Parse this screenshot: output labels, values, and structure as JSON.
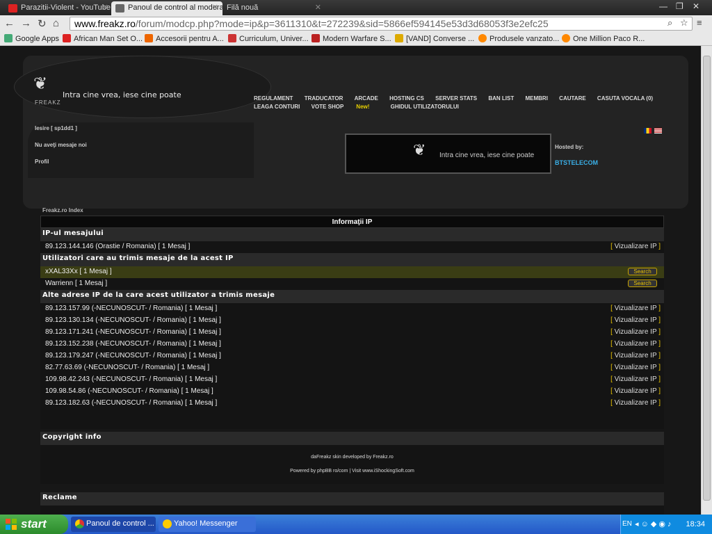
{
  "browser": {
    "tabs": [
      {
        "title": "Parazitii-Violent - YouTube",
        "active": false
      },
      {
        "title": "Panoul de control al moderatorului",
        "active": true
      },
      {
        "title": "Filă nouă",
        "active": false
      }
    ],
    "url_host": "www.freakz.ro",
    "url_path": "/forum/modcp.php?mode=ip&p=3611310&t=272239&sid=5866ef594145e53d3d68053f3e2efc25",
    "bookmarks": [
      "Google Apps",
      "African Man Set O...",
      "Accesorii pentru A...",
      "Curriculum, Univer...",
      "Modern Warfare S...",
      "[VAND] Converse ...",
      "Produsele vanzato...",
      "One Million Paco R..."
    ]
  },
  "site": {
    "logo_name": "FREAKZ",
    "slogan": "Intra cine vrea, iese cine poate",
    "nav": [
      "REGULAMENT",
      "TRADUCATOR",
      "ARCADE",
      "HOSTING CS",
      "SERVER STATS",
      "BAN LIST",
      "MEMBRI",
      "CAUTARE",
      "CASUTA VOCALA (0)",
      "LEAGA CONTURI",
      "VOTE SHOP",
      "GHIDUL UTILIZATORULUI"
    ],
    "new_badge": "New!",
    "user_links": [
      "Iesire [ sp1dd1 ]",
      "Nu aveţi mesaje noi",
      "Profil"
    ],
    "hosted_by": "Hosted by:",
    "host_brand": "BTSTELECOM",
    "breadcrumb": "Freakz.ro Index"
  },
  "ipinfo": {
    "caption": "Informaţii IP",
    "post_ip_heading": "IP-ul mesajului",
    "post_ip": "89.123.144.146 (Orastie / Romania) [ 1 Mesaj ]",
    "view_ip_label": "Vizualizare IP",
    "users_heading": "Utilizatori care au trimis mesaje de la acest IP",
    "users": [
      "xXAL33Xx [ 1 Mesaj ]",
      "Warrienn [ 1 Mesaj ]"
    ],
    "search_label": "Search",
    "other_heading": "Alte adrese IP de la care acest utilizator a trimis mesaje",
    "other_ips": [
      "89.123.157.99 (-NECUNOSCUT- / Romania) [ 1 Mesaj ]",
      "89.123.130.134 (-NECUNOSCUT- / Romania) [ 1 Mesaj ]",
      "89.123.171.241 (-NECUNOSCUT- / Romania) [ 1 Mesaj ]",
      "89.123.152.238 (-NECUNOSCUT- / Romania) [ 1 Mesaj ]",
      "89.123.179.247 (-NECUNOSCUT- / Romania) [ 1 Mesaj ]",
      "82.77.63.69 (-NECUNOSCUT- / Romania) [ 1 Mesaj ]",
      "109.98.42.243 (-NECUNOSCUT- / Romania) [ 1 Mesaj ]",
      "109.98.54.86 (-NECUNOSCUT- / Romania) [ 1 Mesaj ]",
      "89.123.182.63 (-NECUNOSCUT- / Romania) [ 1 Mesaj ]"
    ]
  },
  "footer": {
    "copyright_heading": "Copyright info",
    "skin_credit": "daFreakz skin developed by Freakz.ro",
    "powered_by": "Powered by phpBB ro/com | Visit www.iShockingSoft.com",
    "ads_heading": "Reclame"
  },
  "taskbar": {
    "start_label": "start",
    "tasks": [
      "Panoul de control ...",
      "Yahoo! Messenger"
    ],
    "lang": "EN",
    "clock": "18:34"
  },
  "colors": {
    "accent_yellow": "#e8c200",
    "highlight_row": "#3a3d14",
    "taskbar_blue": "#2458c8"
  }
}
